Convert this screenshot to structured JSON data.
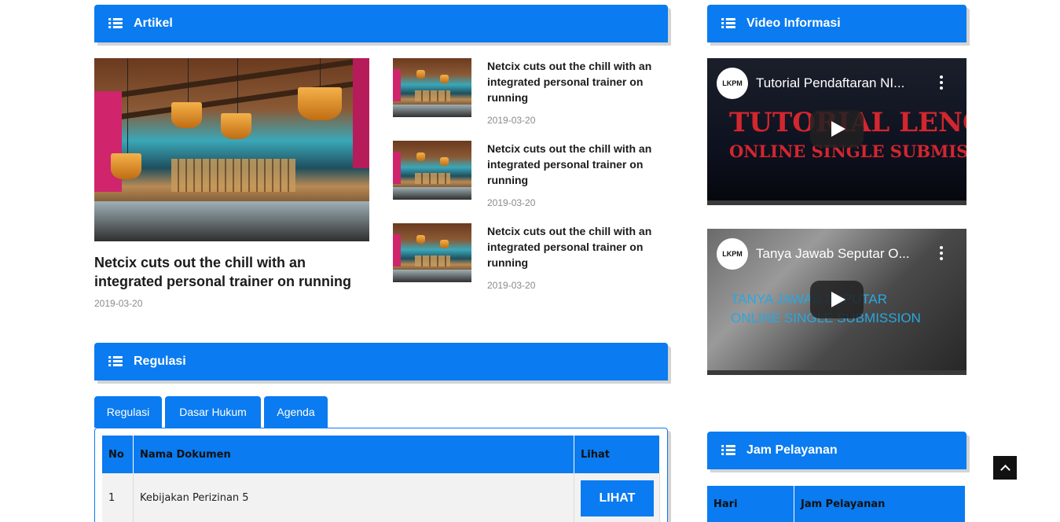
{
  "artikel": {
    "title": "Artikel",
    "featured": {
      "title": "Netcix cuts out the chill with an integrated personal trainer on running",
      "date": "2019-03-20"
    },
    "items": [
      {
        "title": "Netcix cuts out the chill with an integrated personal trainer on running",
        "date": "2019-03-20"
      },
      {
        "title": "Netcix cuts out the chill with an integrated personal trainer on running",
        "date": "2019-03-20"
      },
      {
        "title": "Netcix cuts out the chill with an integrated personal trainer on running",
        "date": "2019-03-20"
      }
    ]
  },
  "video": {
    "title": "Video Informasi",
    "items": [
      {
        "title": "Tutorial Pendaftaran NI...",
        "overlay": "TUTORIAL LENGKAP",
        "overlay2": "ONLINE SINGLE SUBMISSION",
        "logo": "LKPM"
      },
      {
        "title": "Tanya Jawab Seputar O...",
        "overlay": "TANYA JAWAB SEPUTAR",
        "overlay2": "ONLINE SINGLE SUBMISSION",
        "logo": "LKPM"
      }
    ]
  },
  "regulasi": {
    "title": "Regulasi",
    "tabs": [
      "Regulasi",
      "Dasar Hukum",
      "Agenda"
    ],
    "columns": [
      "No",
      "Nama Dokumen",
      "Lihat"
    ],
    "rows": [
      {
        "no": "1",
        "nama": "Kebijakan Perizinan 5",
        "action": "LIHAT"
      }
    ]
  },
  "jam": {
    "title": "Jam Pelayanan",
    "columns": [
      "Hari",
      "Jam Pelayanan"
    ]
  },
  "colors": {
    "primary": "#0a7bf0",
    "shadow": "#d4d4d4",
    "dark": "#111111"
  },
  "icons": {
    "section": "list-icon",
    "play": "play-icon",
    "menu": "kebab-menu-icon",
    "top": "chevron-up-icon"
  }
}
